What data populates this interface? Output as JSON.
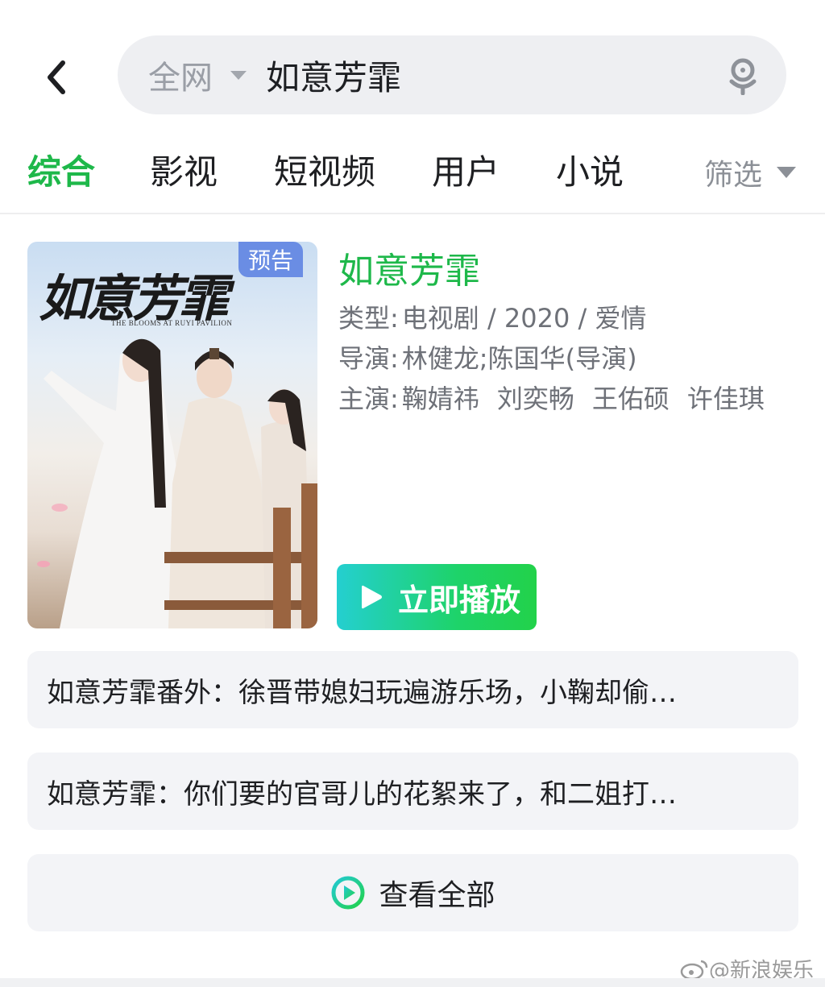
{
  "search": {
    "scope": "全网",
    "query": "如意芳霏"
  },
  "tabs": [
    {
      "label": "综合",
      "active": true
    },
    {
      "label": "影视",
      "active": false
    },
    {
      "label": "短视频",
      "active": false
    },
    {
      "label": "用户",
      "active": false
    },
    {
      "label": "小说",
      "active": false
    }
  ],
  "filter_label": "筛选",
  "result": {
    "poster_title": "如意芳霏",
    "poster_subtitle": "THE BLOOMS AT RUYI PAVILION",
    "badge": "预告",
    "title": "如意芳霏",
    "type_label": "类型:",
    "type_value": "电视剧 / 2020 / 爱情",
    "director_label": "导演:",
    "director_value": "林健龙;陈国华(导演)",
    "cast_label": "主演:",
    "cast": [
      "鞠婧祎",
      "刘奕畅",
      "王佑硕",
      "许佳琪"
    ],
    "play_label": "立即播放"
  },
  "related": [
    "如意芳霏番外：徐晋带媳妇玩遍游乐场，小鞠却偷…",
    "如意芳霏：你们要的官哥儿的花絮来了，和二姐打…"
  ],
  "view_all_label": "查看全部",
  "watermark": "@新浪娱乐",
  "colors": {
    "accent_green": "#1eb84a",
    "badge_blue": "#6a8de4",
    "row_bg": "#f3f4f7"
  },
  "icons": [
    "back-arrow-icon",
    "dropdown-caret-icon",
    "microphone-icon",
    "play-icon",
    "play-circle-icon",
    "weibo-icon"
  ]
}
